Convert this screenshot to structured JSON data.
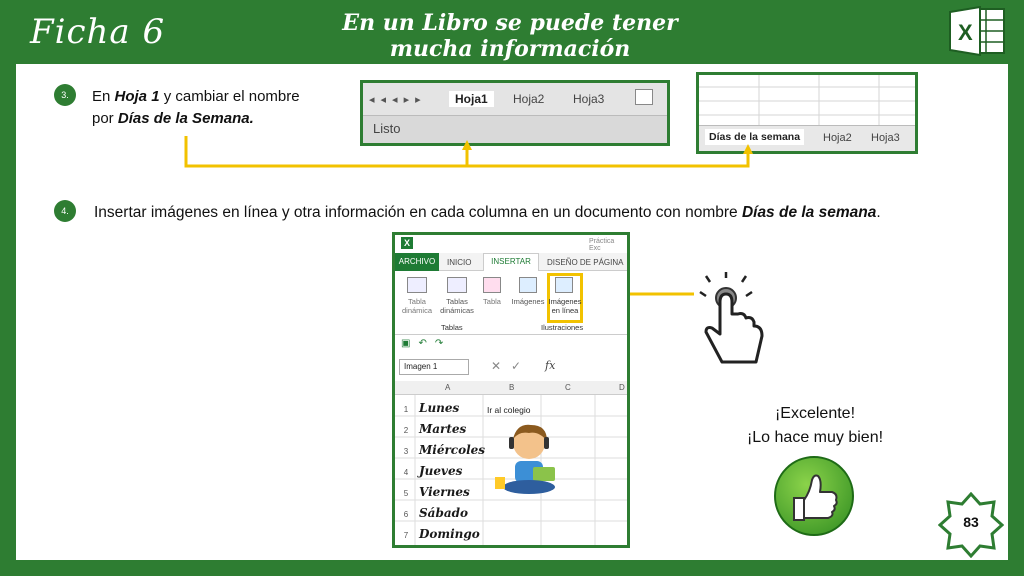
{
  "header": {
    "ficha": "Ficha 6",
    "title_line1": "En un Libro se puede tener",
    "title_line2": "mucha información"
  },
  "step3": {
    "num": "3.",
    "text_pre": "En ",
    "hoja1": "Hoja 1",
    "text_mid": " y cambiar el nombre",
    "text_por": "por ",
    "dias": "Días de la Semana."
  },
  "step4": {
    "num": "4.",
    "text": "Insertar imágenes en línea y otra información en cada columna en un documento con nombre ",
    "dias": "Días de la semana",
    "dot": "."
  },
  "sheet_tabs_before": {
    "tab1": "Hoja1",
    "tab2": "Hoja2",
    "tab3": "Hoja3",
    "status": "Listo"
  },
  "sheet_tabs_after": {
    "tab1": "Días de la semana",
    "tab2": "Hoja2",
    "tab3": "Hoja3"
  },
  "ribbon": {
    "doc_title": "Práctica Exc",
    "tabs": [
      "ARCHIVO",
      "INICIO",
      "INSERTAR",
      "DISEÑO DE PÁGINA"
    ],
    "btn_tabla_dinamica": "Tabla dinámica",
    "btn_tablas_dinamicas": "Tablas dinámicas",
    "btn_tabla": "Tabla",
    "btn_imagenes": "Imágenes",
    "btn_imagenes_linea": "Imágenes en línea",
    "group_tablas": "Tablas",
    "group_ilustraciones": "Ilustraciones",
    "name_box": "Imagen 1",
    "col_headers": [
      "A",
      "B",
      "C",
      "D"
    ],
    "rows": [
      {
        "num": "1",
        "a": "Lunes",
        "b": "Ir al colegio"
      },
      {
        "num": "2",
        "a": "Martes",
        "b": ""
      },
      {
        "num": "3",
        "a": "Miércoles",
        "b": ""
      },
      {
        "num": "4",
        "a": "Jueves",
        "b": ""
      },
      {
        "num": "5",
        "a": "Viernes",
        "b": ""
      },
      {
        "num": "6",
        "a": "Sábado",
        "b": ""
      },
      {
        "num": "7",
        "a": "Domingo",
        "b": ""
      }
    ]
  },
  "praise": {
    "line1": "¡Excelente!",
    "line2": "¡Lo hace muy bien!"
  },
  "page_number": "83",
  "colors": {
    "brand_green": "#2e7d32",
    "highlight_yellow": "#f2c200"
  }
}
